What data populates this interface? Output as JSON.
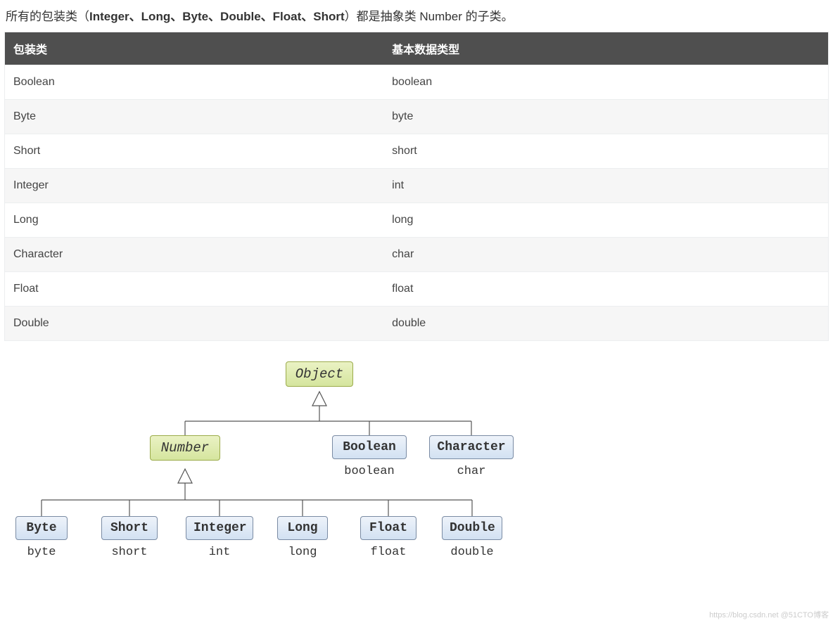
{
  "intro": {
    "prefix": "所有的包装类",
    "paren_open": "（",
    "bold": "Integer、Long、Byte、Double、Float、Short",
    "paren_close": "）",
    "suffix": "都是抽象类 Number 的子类。"
  },
  "table": {
    "header_wrapper": "包装类",
    "header_primitive": "基本数据类型",
    "rows": [
      {
        "wrapper": "Boolean",
        "primitive": "boolean"
      },
      {
        "wrapper": "Byte",
        "primitive": "byte"
      },
      {
        "wrapper": "Short",
        "primitive": "short"
      },
      {
        "wrapper": "Integer",
        "primitive": "int"
      },
      {
        "wrapper": "Long",
        "primitive": "long"
      },
      {
        "wrapper": "Character",
        "primitive": "char"
      },
      {
        "wrapper": "Float",
        "primitive": "float"
      },
      {
        "wrapper": "Double",
        "primitive": "double"
      }
    ]
  },
  "diagram": {
    "object": "Object",
    "number": "Number",
    "boolean_box": "Boolean",
    "boolean_sub": "boolean",
    "character_box": "Character",
    "character_sub": "char",
    "children": [
      {
        "box": "Byte",
        "sub": "byte"
      },
      {
        "box": "Short",
        "sub": "short"
      },
      {
        "box": "Integer",
        "sub": "int"
      },
      {
        "box": "Long",
        "sub": "long"
      },
      {
        "box": "Float",
        "sub": "float"
      },
      {
        "box": "Double",
        "sub": "double"
      }
    ]
  },
  "watermark": "https://blog.csdn.net @51CTO博客"
}
